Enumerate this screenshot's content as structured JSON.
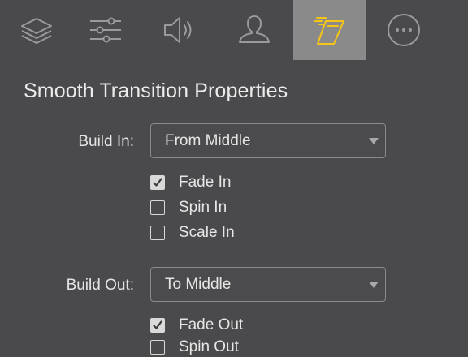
{
  "toolbar": {
    "tabs": [
      {
        "icon": "layers-icon",
        "active": false
      },
      {
        "icon": "sliders-icon",
        "active": false
      },
      {
        "icon": "speaker-icon",
        "active": false
      },
      {
        "icon": "person-icon",
        "active": false
      },
      {
        "icon": "smooth-transition-icon",
        "active": true
      },
      {
        "icon": "more-icon",
        "active": false
      }
    ],
    "active_color": "#8a8a8a",
    "accent_color": "#f5c518"
  },
  "panel": {
    "title": "Smooth Transition Properties"
  },
  "build_in": {
    "label": "Build In:",
    "selected": "From Middle",
    "options": [
      {
        "label": "Fade In",
        "checked": true
      },
      {
        "label": "Spin In",
        "checked": false
      },
      {
        "label": "Scale In",
        "checked": false
      }
    ]
  },
  "build_out": {
    "label": "Build Out:",
    "selected": "To Middle",
    "options": [
      {
        "label": "Fade Out",
        "checked": true
      },
      {
        "label": "Spin Out",
        "checked": false
      }
    ]
  }
}
